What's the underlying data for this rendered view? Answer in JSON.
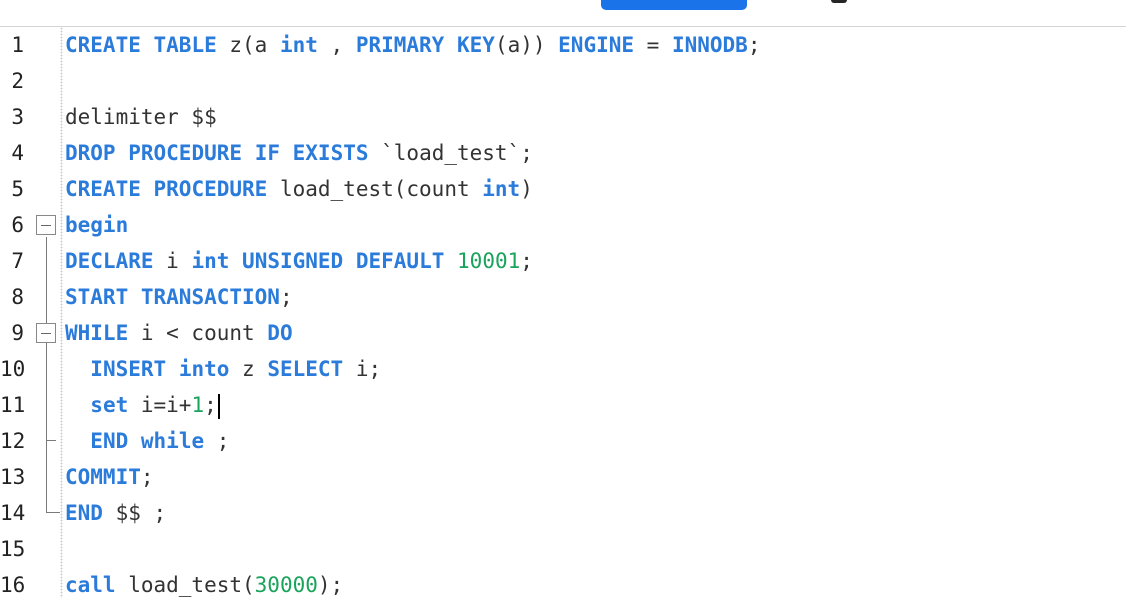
{
  "lines": [
    {
      "num": "1",
      "tokens": [
        {
          "t": "kw",
          "v": "CREATE"
        },
        {
          "t": "plain",
          "v": " "
        },
        {
          "t": "kw",
          "v": "TABLE"
        },
        {
          "t": "plain",
          "v": " z(a "
        },
        {
          "t": "kw",
          "v": "int"
        },
        {
          "t": "plain",
          "v": " , "
        },
        {
          "t": "kw",
          "v": "PRIMARY"
        },
        {
          "t": "plain",
          "v": " "
        },
        {
          "t": "kw",
          "v": "KEY"
        },
        {
          "t": "plain",
          "v": "(a)) "
        },
        {
          "t": "kw",
          "v": "ENGINE"
        },
        {
          "t": "plain",
          "v": " = "
        },
        {
          "t": "kw",
          "v": "INNODB"
        },
        {
          "t": "plain",
          "v": ";"
        }
      ]
    },
    {
      "num": "2",
      "tokens": []
    },
    {
      "num": "3",
      "tokens": [
        {
          "t": "plain",
          "v": "delimiter $$"
        }
      ]
    },
    {
      "num": "4",
      "tokens": [
        {
          "t": "kw",
          "v": "DROP"
        },
        {
          "t": "plain",
          "v": " "
        },
        {
          "t": "kw",
          "v": "PROCEDURE"
        },
        {
          "t": "plain",
          "v": " "
        },
        {
          "t": "kw",
          "v": "IF"
        },
        {
          "t": "plain",
          "v": " "
        },
        {
          "t": "kw",
          "v": "EXISTS"
        },
        {
          "t": "plain",
          "v": " `load_test`;"
        }
      ]
    },
    {
      "num": "5",
      "tokens": [
        {
          "t": "kw",
          "v": "CREATE"
        },
        {
          "t": "plain",
          "v": " "
        },
        {
          "t": "kw",
          "v": "PROCEDURE"
        },
        {
          "t": "plain",
          "v": " load_test(count "
        },
        {
          "t": "kw",
          "v": "int"
        },
        {
          "t": "plain",
          "v": ")"
        }
      ]
    },
    {
      "num": "6",
      "tokens": [
        {
          "t": "kw",
          "v": "begin"
        }
      ]
    },
    {
      "num": "7",
      "tokens": [
        {
          "t": "kw",
          "v": "DECLARE"
        },
        {
          "t": "plain",
          "v": " i "
        },
        {
          "t": "kw",
          "v": "int"
        },
        {
          "t": "plain",
          "v": " "
        },
        {
          "t": "kw",
          "v": "UNSIGNED"
        },
        {
          "t": "plain",
          "v": " "
        },
        {
          "t": "kw",
          "v": "DEFAULT"
        },
        {
          "t": "plain",
          "v": " "
        },
        {
          "t": "num",
          "v": "10001"
        },
        {
          "t": "plain",
          "v": ";"
        }
      ]
    },
    {
      "num": "8",
      "tokens": [
        {
          "t": "kw",
          "v": "START"
        },
        {
          "t": "plain",
          "v": " "
        },
        {
          "t": "kw",
          "v": "TRANSACTION"
        },
        {
          "t": "plain",
          "v": ";"
        }
      ]
    },
    {
      "num": "9",
      "tokens": [
        {
          "t": "kw",
          "v": "WHILE"
        },
        {
          "t": "plain",
          "v": " i < count "
        },
        {
          "t": "kw",
          "v": "DO"
        }
      ]
    },
    {
      "num": "10",
      "tokens": [
        {
          "t": "plain",
          "v": "  "
        },
        {
          "t": "kw",
          "v": "INSERT"
        },
        {
          "t": "plain",
          "v": " "
        },
        {
          "t": "kw",
          "v": "into"
        },
        {
          "t": "plain",
          "v": " z "
        },
        {
          "t": "kw",
          "v": "SELECT"
        },
        {
          "t": "plain",
          "v": " i;"
        }
      ]
    },
    {
      "num": "11",
      "caret": true,
      "tokens": [
        {
          "t": "plain",
          "v": "  "
        },
        {
          "t": "kw",
          "v": "set"
        },
        {
          "t": "plain",
          "v": " i=i+"
        },
        {
          "t": "num",
          "v": "1"
        },
        {
          "t": "plain",
          "v": ";"
        }
      ]
    },
    {
      "num": "12",
      "tokens": [
        {
          "t": "plain",
          "v": "  "
        },
        {
          "t": "kw",
          "v": "END"
        },
        {
          "t": "plain",
          "v": " "
        },
        {
          "t": "kw",
          "v": "while"
        },
        {
          "t": "plain",
          "v": " ;"
        }
      ]
    },
    {
      "num": "13",
      "tokens": [
        {
          "t": "kw",
          "v": "COMMIT"
        },
        {
          "t": "plain",
          "v": ";"
        }
      ]
    },
    {
      "num": "14",
      "tokens": [
        {
          "t": "kw",
          "v": "END"
        },
        {
          "t": "plain",
          "v": " $$ ;"
        }
      ]
    },
    {
      "num": "15",
      "tokens": []
    },
    {
      "num": "16",
      "tokens": [
        {
          "t": "kw",
          "v": "call"
        },
        {
          "t": "plain",
          "v": " load_test("
        },
        {
          "t": "num",
          "v": "30000"
        },
        {
          "t": "plain",
          "v": ");"
        }
      ]
    }
  ],
  "colors": {
    "keyword": "#2b7bdb",
    "number": "#1aa35a",
    "text": "#333333",
    "accent": "#1a73e8"
  }
}
